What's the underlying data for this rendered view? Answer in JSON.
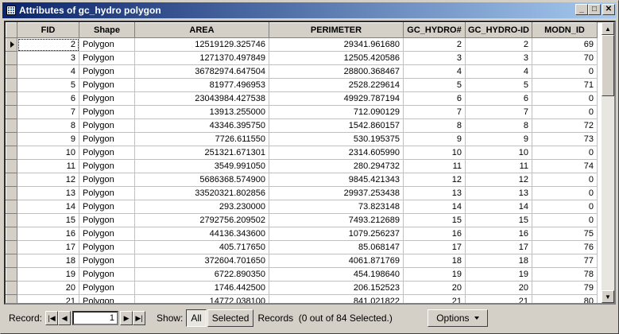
{
  "window": {
    "title": "Attributes of gc_hydro polygon"
  },
  "table": {
    "columns": [
      "FID",
      "Shape",
      "AREA",
      "PERIMETER",
      "GC_HYDRO#",
      "GC_HYDRO-ID",
      "MODN_ID"
    ],
    "rows": [
      [
        "2",
        "Polygon",
        "12519129.325746",
        "29341.961680",
        "2",
        "2",
        "69"
      ],
      [
        "3",
        "Polygon",
        "1271370.497849",
        "12505.420586",
        "3",
        "3",
        "70"
      ],
      [
        "4",
        "Polygon",
        "36782974.647504",
        "28800.368467",
        "4",
        "4",
        "0"
      ],
      [
        "5",
        "Polygon",
        "81977.496953",
        "2528.229614",
        "5",
        "5",
        "71"
      ],
      [
        "6",
        "Polygon",
        "23043984.427538",
        "49929.787194",
        "6",
        "6",
        "0"
      ],
      [
        "7",
        "Polygon",
        "13913.255000",
        "712.090129",
        "7",
        "7",
        "0"
      ],
      [
        "8",
        "Polygon",
        "43346.395750",
        "1542.860157",
        "8",
        "8",
        "72"
      ],
      [
        "9",
        "Polygon",
        "7726.611550",
        "530.195375",
        "9",
        "9",
        "73"
      ],
      [
        "10",
        "Polygon",
        "251321.671301",
        "2314.605990",
        "10",
        "10",
        "0"
      ],
      [
        "11",
        "Polygon",
        "3549.991050",
        "280.294732",
        "11",
        "11",
        "74"
      ],
      [
        "12",
        "Polygon",
        "5686368.574900",
        "9845.421343",
        "12",
        "12",
        "0"
      ],
      [
        "13",
        "Polygon",
        "33520321.802856",
        "29937.253438",
        "13",
        "13",
        "0"
      ],
      [
        "14",
        "Polygon",
        "293.230000",
        "73.823148",
        "14",
        "14",
        "0"
      ],
      [
        "15",
        "Polygon",
        "2792756.209502",
        "7493.212689",
        "15",
        "15",
        "0"
      ],
      [
        "16",
        "Polygon",
        "44136.343600",
        "1079.256237",
        "16",
        "16",
        "75"
      ],
      [
        "17",
        "Polygon",
        "405.717650",
        "85.068147",
        "17",
        "17",
        "76"
      ],
      [
        "18",
        "Polygon",
        "372604.701650",
        "4061.871769",
        "18",
        "18",
        "77"
      ],
      [
        "19",
        "Polygon",
        "6722.890350",
        "454.198640",
        "19",
        "19",
        "78"
      ],
      [
        "20",
        "Polygon",
        "1746.442500",
        "206.152523",
        "20",
        "20",
        "79"
      ],
      [
        "21",
        "Polygon",
        "14772.038100",
        "841.021822",
        "21",
        "21",
        "80"
      ]
    ]
  },
  "status": {
    "record_label": "Record:",
    "record_value": "1",
    "show_label": "Show:",
    "all_label": "All",
    "selected_label": "Selected",
    "records_text": "Records  (0 out of 84 Selected.)",
    "options_label": "Options"
  }
}
